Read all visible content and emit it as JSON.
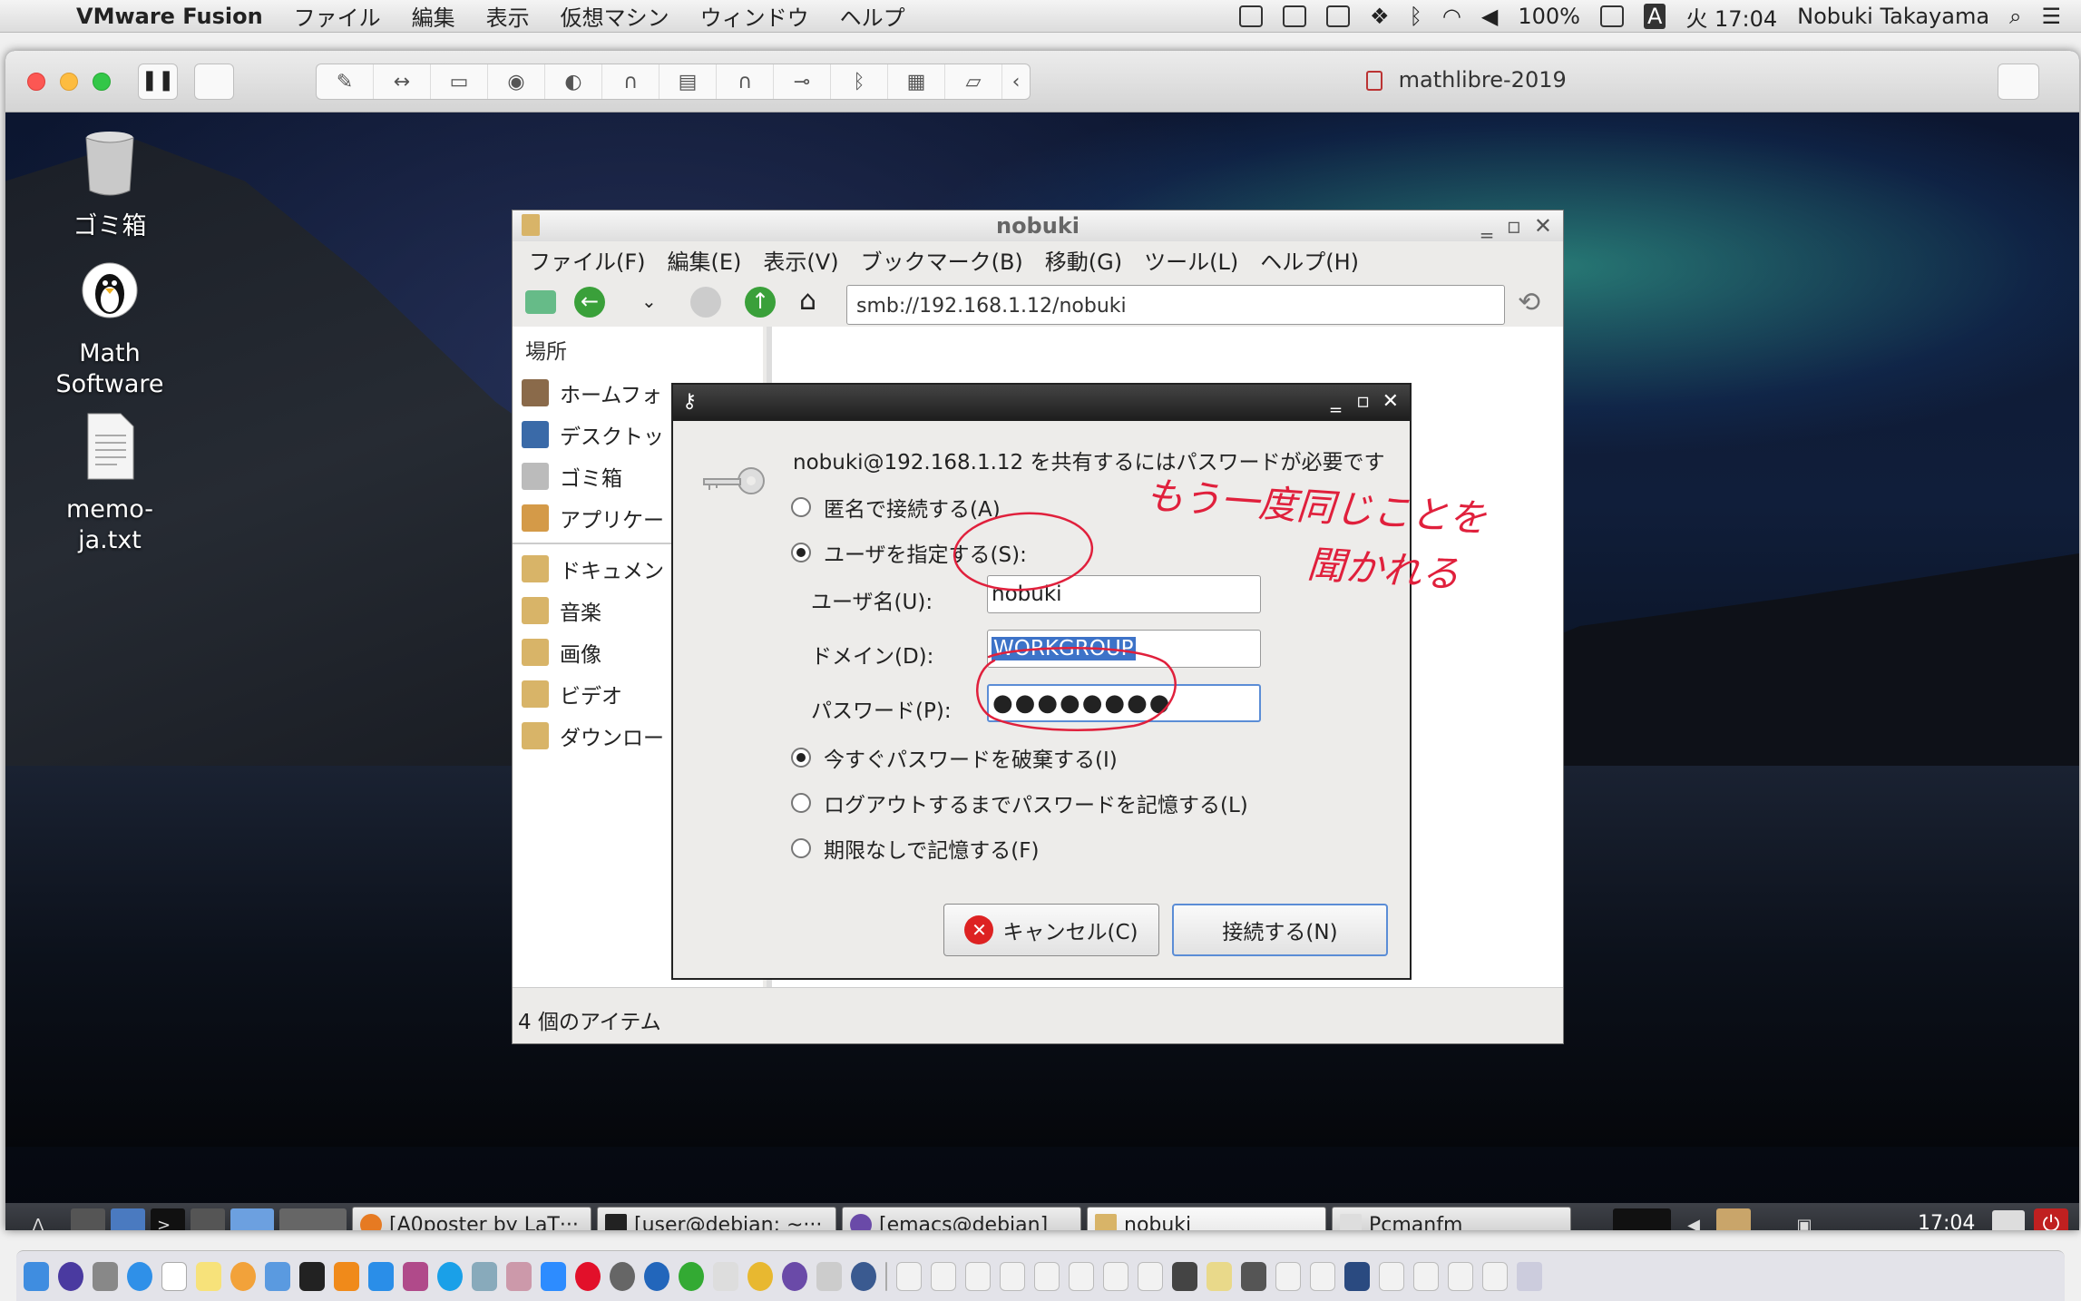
{
  "mac_menubar": {
    "app_name": "VMware Fusion",
    "menus": [
      "ファイル",
      "編集",
      "表示",
      "仮想マシン",
      "ウィンドウ",
      "ヘルプ"
    ],
    "battery": "100%",
    "input_mode": "A",
    "clock": "火 17:04",
    "user": "Nobuki Takayama"
  },
  "fusion": {
    "vm_name": "mathlibre-2019"
  },
  "desktop_icons": [
    {
      "label": "ゴミ箱",
      "icon": "trash-icon"
    },
    {
      "label": "Math Software",
      "icon": "tux-icon"
    },
    {
      "label": "memo-ja.txt",
      "icon": "text-file-icon"
    }
  ],
  "file_manager": {
    "title": "nobuki",
    "menus": [
      "ファイル(F)",
      "編集(E)",
      "表示(V)",
      "ブックマーク(B)",
      "移動(G)",
      "ツール(L)",
      "ヘルプ(H)"
    ],
    "address": "smb://192.168.1.12/nobuki",
    "sidebar_header": "場所",
    "places": [
      {
        "label": "ホームフォ",
        "icon": "home-icon"
      },
      {
        "label": "デスクトッ",
        "icon": "desktop-icon"
      },
      {
        "label": "ゴミ箱",
        "icon": "trash-icon"
      },
      {
        "label": "アプリケー",
        "icon": "applications-icon"
      }
    ],
    "bookmarks": [
      {
        "label": "ドキュメン",
        "icon": "folder-icon"
      },
      {
        "label": "音楽",
        "icon": "folder-icon"
      },
      {
        "label": "画像",
        "icon": "folder-icon"
      },
      {
        "label": "ビデオ",
        "icon": "folder-icon"
      },
      {
        "label": "ダウンロー",
        "icon": "folder-icon"
      }
    ],
    "status": "4 個のアイテム"
  },
  "password_dialog": {
    "prompt": "nobuki@192.168.1.12 を共有するにはパスワードが必要です",
    "connect_options": [
      {
        "label": "匿名で接続する(A)",
        "selected": false
      },
      {
        "label": "ユーザを指定する(S):",
        "selected": true
      }
    ],
    "fields": {
      "username_label": "ユーザ名(U):",
      "username_value": "nobuki",
      "domain_label": "ドメイン(D):",
      "domain_value": "WORKGROUP",
      "password_label": "パスワード(P):",
      "password_value": "●●●●●●●●"
    },
    "remember_options": [
      {
        "label": "今すぐパスワードを破棄する(I)",
        "selected": true
      },
      {
        "label": "ログアウトするまでパスワードを記憶する(L)",
        "selected": false
      },
      {
        "label": "期限なしで記憶する(F)",
        "selected": false
      }
    ],
    "cancel_label": "キャンセル(C)",
    "connect_label": "接続する(N)"
  },
  "annotation_text": "もう一度同じことを聞かれる",
  "taskbar": {
    "tasks": [
      {
        "label": "[A0poster by LaT···",
        "icon": "firefox-icon"
      },
      {
        "label": "[user@debian: ~···",
        "icon": "terminal-icon"
      },
      {
        "label": "[emacs@debian]",
        "icon": "emacs-icon"
      },
      {
        "label": "nobuki",
        "icon": "folder-icon",
        "active": true
      },
      {
        "label": "Pcmanfm",
        "icon": "window-icon"
      }
    ],
    "clock": "17:04"
  },
  "colors": {
    "selection": "#3d73c8",
    "annotation": "#e0203c",
    "focus_border": "#5b8dd6"
  }
}
